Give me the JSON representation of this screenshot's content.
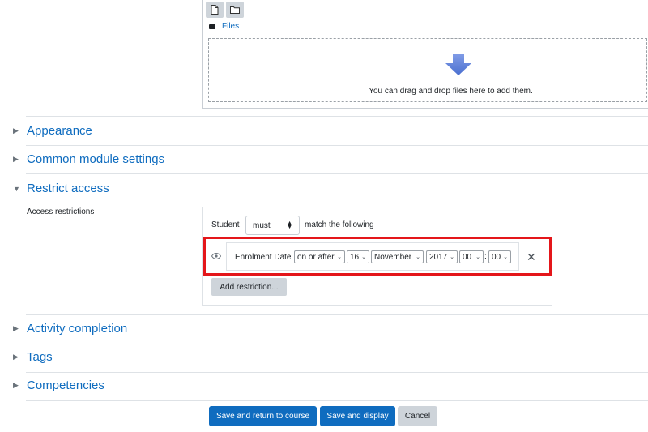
{
  "file_picker": {
    "path_label": "Files",
    "dropzone_text": "You can drag and drop files here to add them."
  },
  "sections": {
    "appearance": "Appearance",
    "common_module": "Common module settings",
    "restrict_access": "Restrict access",
    "activity_completion": "Activity completion",
    "tags": "Tags",
    "competencies": "Competencies"
  },
  "restrict": {
    "field_label": "Access restrictions",
    "student_label": "Student",
    "must_value": "must",
    "match_label": "match the following",
    "condition": {
      "label": "Enrolment Date",
      "operator": "on or after",
      "day": "16",
      "month": "November",
      "year": "2017",
      "hour": "00",
      "minute": "00",
      "colon": ":"
    },
    "remove_symbol": "✕",
    "add_restriction": "Add restriction..."
  },
  "actions": {
    "save_return": "Save and return to course",
    "save_display": "Save and display",
    "cancel": "Cancel"
  },
  "colors": {
    "link": "#0f6cbf",
    "highlight": "#e4161a",
    "primary": "#0f6cbf",
    "secondary": "#ced4da"
  }
}
